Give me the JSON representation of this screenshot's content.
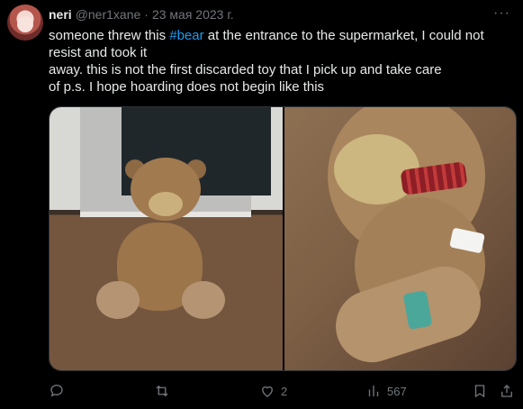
{
  "tweet": {
    "author": {
      "name": "neri",
      "handle": "@ner1xane",
      "separator": "·",
      "date": "23 мая 2023 г."
    },
    "more_label": "···",
    "text": {
      "line1_before": "someone threw this ",
      "hashtag": "#bear",
      "line1_after": " at the entrance to the supermarket, I could not resist and took it",
      "line2": "away. this is not the first discarded toy that I pick up and take care",
      "line3": "of p.s. I hope hoarding does not begin like this"
    },
    "stats": {
      "replies": "",
      "retweets": "",
      "likes": "2",
      "views": "567"
    },
    "icons": {
      "reply": "reply-icon",
      "retweet": "retweet-icon",
      "like": "heart-icon",
      "views": "views-icon",
      "bookmark": "bookmark-icon",
      "share": "share-icon",
      "more": "more-icon"
    }
  }
}
